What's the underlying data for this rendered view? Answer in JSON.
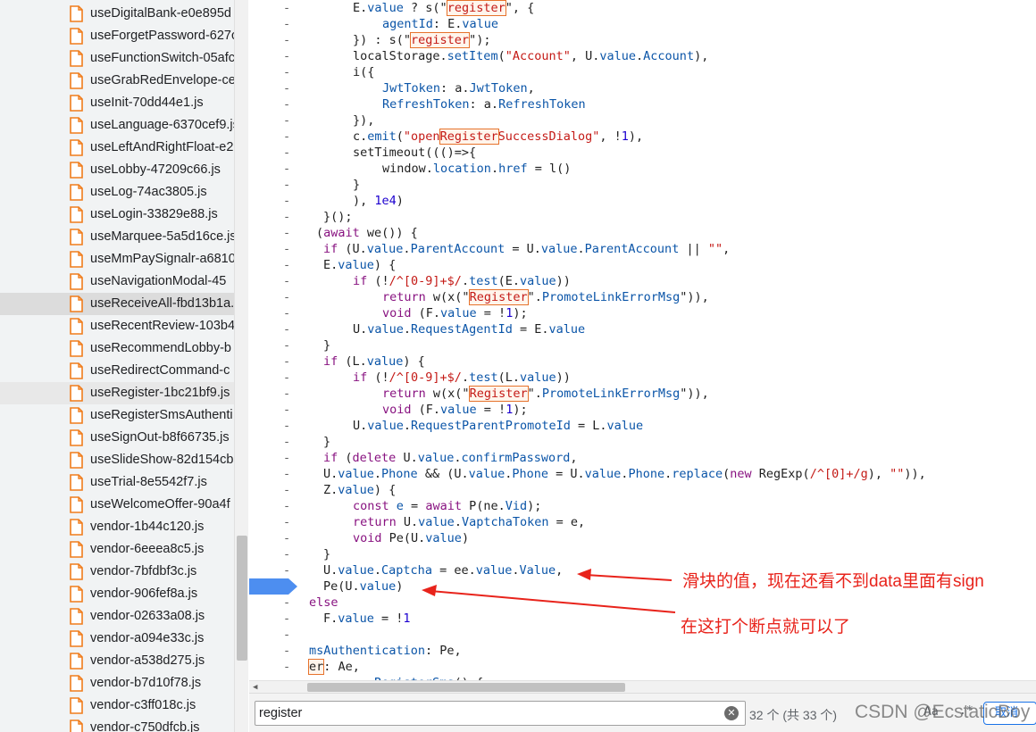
{
  "file_tree": {
    "files": [
      {
        "name": "useDigitalBank-e0e895d"
      },
      {
        "name": "useForgetPassword-627c"
      },
      {
        "name": "useFunctionSwitch-05afc"
      },
      {
        "name": "useGrabRedEnvelope-ce"
      },
      {
        "name": "useInit-70dd44e1.js"
      },
      {
        "name": "useLanguage-6370cef9.js"
      },
      {
        "name": "useLeftAndRightFloat-e2"
      },
      {
        "name": "useLobby-47209c66.js"
      },
      {
        "name": "useLog-74ac3805.js"
      },
      {
        "name": "useLogin-33829e88.js"
      },
      {
        "name": "useMarquee-5a5d16ce.js"
      },
      {
        "name": "useMmPaySignalr-a6810"
      },
      {
        "name": "useNavigationModal-45"
      },
      {
        "name": "useReceiveAll-fbd13b1a."
      },
      {
        "name": "useRecentReview-103b4"
      },
      {
        "name": "useRecommendLobby-b"
      },
      {
        "name": "useRedirectCommand-c"
      },
      {
        "name": "useRegister-1bc21bf9.js"
      },
      {
        "name": "useRegisterSmsAuthenti"
      },
      {
        "name": "useSignOut-b8f66735.js"
      },
      {
        "name": "useSlideShow-82d154cb"
      },
      {
        "name": "useTrial-8e5542f7.js"
      },
      {
        "name": "useWelcomeOffer-90a4f"
      },
      {
        "name": "vendor-1b44c120.js"
      },
      {
        "name": "vendor-6eeea8c5.js"
      },
      {
        "name": "vendor-7bfdbf3c.js"
      },
      {
        "name": "vendor-906fef8a.js"
      },
      {
        "name": "vendor-02633a08.js"
      },
      {
        "name": "vendor-a094e33c.js"
      },
      {
        "name": "vendor-a538d275.js"
      },
      {
        "name": "vendor-b7d10f78.js"
      },
      {
        "name": "vendor-c3ff018c.js"
      },
      {
        "name": "vendor-c750dfcb.js"
      }
    ],
    "hover_index": 13,
    "selected_index": 17
  },
  "code": {
    "gutter_mark": "-",
    "breakpoint_line": 36,
    "lines": [
      {
        "indent": 116,
        "tokens": [
          [
            "E.",
            ""
          ],
          [
            "value",
            "prop"
          ],
          [
            " ? s(\"",
            ""
          ],
          [
            "register",
            "match"
          ],
          [
            "\", {",
            ""
          ]
        ]
      },
      {
        "indent": 149,
        "tokens": [
          [
            "agentId",
            "prop"
          ],
          [
            ": E.",
            ""
          ],
          [
            "value",
            "prop"
          ]
        ]
      },
      {
        "indent": 116,
        "tokens": [
          [
            "}) : s(\"",
            ""
          ],
          [
            "register",
            "match"
          ],
          [
            "\");",
            ""
          ]
        ]
      },
      {
        "indent": 116,
        "tokens": [
          [
            "localStorage.",
            ""
          ],
          [
            "setItem",
            "prop"
          ],
          [
            "(",
            ""
          ],
          [
            "\"Account\"",
            "str"
          ],
          [
            ", U.",
            ""
          ],
          [
            "value",
            "prop"
          ],
          [
            ".",
            ""
          ],
          [
            "Account",
            "prop"
          ],
          [
            "),",
            ""
          ]
        ]
      },
      {
        "indent": 116,
        "tokens": [
          [
            "i({",
            ""
          ]
        ]
      },
      {
        "indent": 149,
        "tokens": [
          [
            "JwtToken",
            "prop"
          ],
          [
            ": a.",
            ""
          ],
          [
            "JwtToken",
            "prop"
          ],
          [
            ",",
            ""
          ]
        ]
      },
      {
        "indent": 149,
        "tokens": [
          [
            "RefreshToken",
            "prop"
          ],
          [
            ": a.",
            ""
          ],
          [
            "RefreshToken",
            "prop"
          ]
        ]
      },
      {
        "indent": 116,
        "tokens": [
          [
            "}),",
            ""
          ]
        ]
      },
      {
        "indent": 116,
        "tokens": [
          [
            "c.",
            ""
          ],
          [
            "emit",
            "prop"
          ],
          [
            "(",
            ""
          ],
          [
            "\"open",
            "str"
          ],
          [
            "Register",
            "match"
          ],
          [
            "SuccessDialog\"",
            "str"
          ],
          [
            ", !",
            ""
          ],
          [
            "1",
            "num"
          ],
          [
            "),",
            ""
          ]
        ]
      },
      {
        "indent": 116,
        "tokens": [
          [
            "setTimeout((()=>{",
            ""
          ]
        ]
      },
      {
        "indent": 149,
        "tokens": [
          [
            "window.",
            ""
          ],
          [
            "location",
            "prop"
          ],
          [
            ".",
            ""
          ],
          [
            "href",
            "prop"
          ],
          [
            " = l()",
            ""
          ]
        ]
      },
      {
        "indent": 116,
        "tokens": [
          [
            "}",
            ""
          ]
        ]
      },
      {
        "indent": 116,
        "tokens": [
          [
            "), ",
            ""
          ],
          [
            "1e4",
            "num"
          ],
          [
            ")",
            ""
          ]
        ]
      },
      {
        "indent": 83,
        "tokens": [
          [
            "}();",
            ""
          ]
        ]
      },
      {
        "indent": 75,
        "tokens": [
          [
            "(",
            ""
          ],
          [
            "await",
            "kw"
          ],
          [
            " we()) {",
            ""
          ]
        ]
      },
      {
        "indent": 83,
        "tokens": [
          [
            "if",
            "kw"
          ],
          [
            " (U.",
            ""
          ],
          [
            "value",
            "prop"
          ],
          [
            ".",
            ""
          ],
          [
            "ParentAccount",
            "prop"
          ],
          [
            " = U.",
            ""
          ],
          [
            "value",
            "prop"
          ],
          [
            ".",
            ""
          ],
          [
            "ParentAccount",
            "prop"
          ],
          [
            " || ",
            ""
          ],
          [
            "\"\"",
            "str"
          ],
          [
            ",",
            ""
          ]
        ]
      },
      {
        "indent": 83,
        "tokens": [
          [
            "E.",
            ""
          ],
          [
            "value",
            "prop"
          ],
          [
            ") {",
            ""
          ]
        ]
      },
      {
        "indent": 116,
        "tokens": [
          [
            "if",
            "kw"
          ],
          [
            " (!",
            ""
          ],
          [
            "/^[0-9]+$/",
            "str"
          ],
          [
            ".",
            ""
          ],
          [
            "test",
            "prop"
          ],
          [
            "(E.",
            ""
          ],
          [
            "value",
            "prop"
          ],
          [
            "))",
            ""
          ]
        ]
      },
      {
        "indent": 149,
        "tokens": [
          [
            "return",
            "kw"
          ],
          [
            " w(x(\"",
            ""
          ],
          [
            "Register",
            "match"
          ],
          [
            "\".",
            ""
          ],
          [
            "PromoteLinkErrorMsg",
            "prop"
          ],
          [
            "\")),",
            ""
          ]
        ]
      },
      {
        "indent": 149,
        "tokens": [
          [
            "void",
            "kw"
          ],
          [
            " (F.",
            ""
          ],
          [
            "value",
            "prop"
          ],
          [
            " = !",
            ""
          ],
          [
            "1",
            "num"
          ],
          [
            ");",
            ""
          ]
        ]
      },
      {
        "indent": 116,
        "tokens": [
          [
            "U.",
            ""
          ],
          [
            "value",
            "prop"
          ],
          [
            ".",
            ""
          ],
          [
            "RequestAgentId",
            "prop"
          ],
          [
            " = E.",
            ""
          ],
          [
            "value",
            "prop"
          ]
        ]
      },
      {
        "indent": 83,
        "tokens": [
          [
            "}",
            ""
          ]
        ]
      },
      {
        "indent": 83,
        "tokens": [
          [
            "if",
            "kw"
          ],
          [
            " (L.",
            ""
          ],
          [
            "value",
            "prop"
          ],
          [
            ") {",
            ""
          ]
        ]
      },
      {
        "indent": 116,
        "tokens": [
          [
            "if",
            "kw"
          ],
          [
            " (!",
            ""
          ],
          [
            "/^[0-9]+$/",
            "str"
          ],
          [
            ".",
            ""
          ],
          [
            "test",
            "prop"
          ],
          [
            "(L.",
            ""
          ],
          [
            "value",
            "prop"
          ],
          [
            "))",
            ""
          ]
        ]
      },
      {
        "indent": 149,
        "tokens": [
          [
            "return",
            "kw"
          ],
          [
            " w(x(\"",
            ""
          ],
          [
            "Register",
            "match"
          ],
          [
            "\".",
            ""
          ],
          [
            "PromoteLinkErrorMsg",
            "prop"
          ],
          [
            "\")),",
            ""
          ]
        ]
      },
      {
        "indent": 149,
        "tokens": [
          [
            "void",
            "kw"
          ],
          [
            " (F.",
            ""
          ],
          [
            "value",
            "prop"
          ],
          [
            " = !",
            ""
          ],
          [
            "1",
            "num"
          ],
          [
            ");",
            ""
          ]
        ]
      },
      {
        "indent": 116,
        "tokens": [
          [
            "U.",
            ""
          ],
          [
            "value",
            "prop"
          ],
          [
            ".",
            ""
          ],
          [
            "RequestParentPromoteId",
            "prop"
          ],
          [
            " = L.",
            ""
          ],
          [
            "value",
            "prop"
          ]
        ]
      },
      {
        "indent": 83,
        "tokens": [
          [
            "}",
            ""
          ]
        ]
      },
      {
        "indent": 83,
        "tokens": [
          [
            "if",
            "kw"
          ],
          [
            " (",
            ""
          ],
          [
            "delete",
            "kw"
          ],
          [
            " U.",
            ""
          ],
          [
            "value",
            "prop"
          ],
          [
            ".",
            ""
          ],
          [
            "confirmPassword",
            "prop"
          ],
          [
            ",",
            ""
          ]
        ]
      },
      {
        "indent": 83,
        "tokens": [
          [
            "U.",
            ""
          ],
          [
            "value",
            "prop"
          ],
          [
            ".",
            ""
          ],
          [
            "Phone",
            "prop"
          ],
          [
            " && (U.",
            ""
          ],
          [
            "value",
            "prop"
          ],
          [
            ".",
            ""
          ],
          [
            "Phone",
            "prop"
          ],
          [
            " = U.",
            ""
          ],
          [
            "value",
            "prop"
          ],
          [
            ".",
            ""
          ],
          [
            "Phone",
            "prop"
          ],
          [
            ".",
            ""
          ],
          [
            "replace",
            "prop"
          ],
          [
            "(",
            ""
          ],
          [
            "new",
            "kw"
          ],
          [
            " RegExp(",
            ""
          ],
          [
            "/^[0]+/g",
            "str"
          ],
          [
            "), ",
            ""
          ],
          [
            "\"\"",
            "str"
          ],
          [
            ")),",
            ""
          ]
        ]
      },
      {
        "indent": 83,
        "tokens": [
          [
            "Z.",
            ""
          ],
          [
            "value",
            "prop"
          ],
          [
            ") {",
            ""
          ]
        ]
      },
      {
        "indent": 116,
        "tokens": [
          [
            "const",
            "kw"
          ],
          [
            " ",
            ""
          ],
          [
            "e",
            "prop"
          ],
          [
            " = ",
            ""
          ],
          [
            "await",
            "kw"
          ],
          [
            " P(ne.",
            ""
          ],
          [
            "Vid",
            "prop"
          ],
          [
            ");",
            ""
          ]
        ]
      },
      {
        "indent": 116,
        "tokens": [
          [
            "return",
            "kw"
          ],
          [
            " U.",
            ""
          ],
          [
            "value",
            "prop"
          ],
          [
            ".",
            ""
          ],
          [
            "VaptchaToken",
            "prop"
          ],
          [
            " = e,",
            ""
          ]
        ]
      },
      {
        "indent": 116,
        "tokens": [
          [
            "void",
            "kw"
          ],
          [
            " Pe(U.",
            ""
          ],
          [
            "value",
            "prop"
          ],
          [
            ")",
            ""
          ]
        ]
      },
      {
        "indent": 83,
        "tokens": [
          [
            "}",
            ""
          ]
        ]
      },
      {
        "indent": 83,
        "tokens": [
          [
            "U.",
            ""
          ],
          [
            "value",
            "prop"
          ],
          [
            ".",
            ""
          ],
          [
            "Captcha",
            "prop"
          ],
          [
            " = ee.",
            ""
          ],
          [
            "value",
            "prop"
          ],
          [
            ".",
            ""
          ],
          [
            "Value",
            "prop"
          ],
          [
            ",",
            ""
          ]
        ]
      },
      {
        "indent": 83,
        "tokens": [
          [
            "Pe(U.",
            ""
          ],
          [
            "value",
            "prop"
          ],
          [
            ")",
            ""
          ]
        ]
      },
      {
        "indent": 67,
        "tokens": [
          [
            "else",
            "kw"
          ]
        ]
      },
      {
        "indent": 83,
        "tokens": [
          [
            "F.",
            ""
          ],
          [
            "value",
            "prop"
          ],
          [
            " = !",
            ""
          ],
          [
            "1",
            "num"
          ]
        ]
      },
      {
        "indent": 67,
        "tokens": []
      },
      {
        "indent": 67,
        "tokens": [
          [
            "msAuthentication",
            "prop"
          ],
          [
            ": Pe,",
            ""
          ]
        ]
      },
      {
        "indent": 67,
        "tokens": [
          [
            "er",
            "matchplain"
          ],
          [
            ": Ae,",
            ""
          ]
        ]
      },
      {
        "indent": 67,
        "tokens": [
          [
            "         ",
            ""
          ],
          [
            "RegisterSms",
            "prop"
          ],
          [
            "() {",
            ""
          ]
        ]
      }
    ]
  },
  "annotations": {
    "note_slider": "滑块的值，现在还看不到data里面有sign",
    "note_breakpoint": "在这打个断点就可以了",
    "arrow_color": "#e8231b"
  },
  "search": {
    "query": "register",
    "count": "32 个 (共 33 个)",
    "case_label": "Aa",
    "regex_label": ".*",
    "cancel_label": "取消"
  },
  "watermark": "CSDN @EcstaticBoy",
  "colors": {
    "accent": "#1a73e8",
    "match_outline": "#e6722b",
    "file_icon": "#f07c1b",
    "breakpoint": "#4d8ef0"
  }
}
